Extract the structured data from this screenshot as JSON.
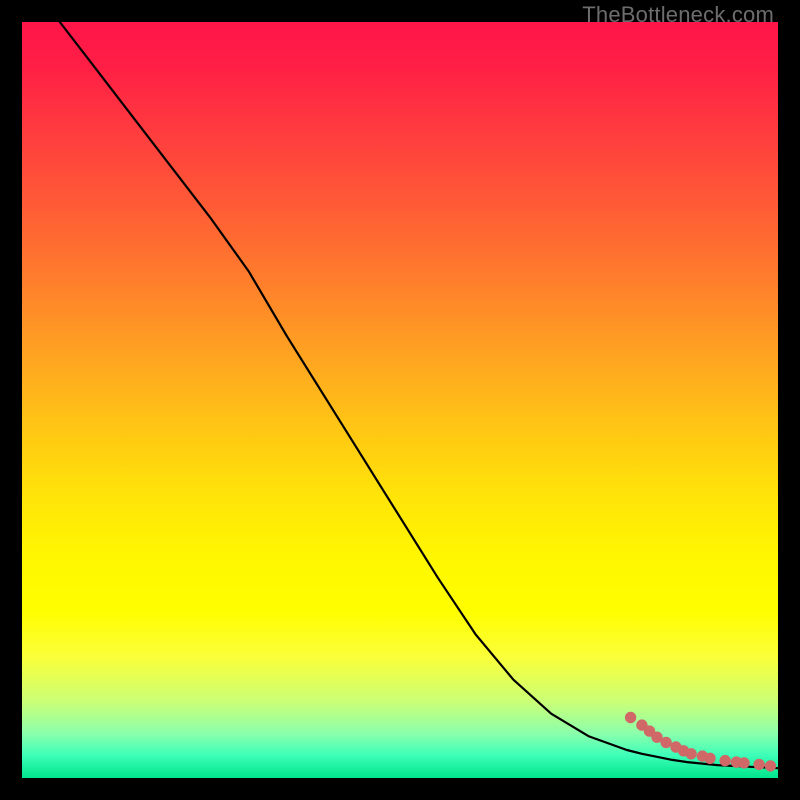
{
  "watermark": "TheBottleneck.com",
  "colors": {
    "curve": "#000000",
    "dot": "#d16868",
    "background": "#000000"
  },
  "chart_data": {
    "type": "line",
    "title": "",
    "xlabel": "",
    "ylabel": "",
    "xlim": [
      0,
      100
    ],
    "ylim": [
      0,
      100
    ],
    "grid": false,
    "series": [
      {
        "name": "curve",
        "kind": "line",
        "x": [
          5,
          10,
          15,
          20,
          25,
          30,
          35,
          40,
          45,
          50,
          55,
          60,
          65,
          70,
          75,
          80,
          82,
          84,
          86,
          88,
          90,
          92,
          94,
          96,
          98,
          100
        ],
        "y": [
          100,
          93.5,
          87,
          80.5,
          74,
          67,
          58.5,
          50.5,
          42.5,
          34.5,
          26.5,
          19,
          13,
          8.5,
          5.5,
          3.7,
          3.2,
          2.8,
          2.4,
          2.1,
          1.9,
          1.7,
          1.6,
          1.5,
          1.4,
          1.3
        ]
      },
      {
        "name": "dots",
        "kind": "scatter",
        "x": [
          80.5,
          82.0,
          83.0,
          84.0,
          85.2,
          86.5,
          87.5,
          88.5,
          90.0,
          91.0,
          93.0,
          94.5,
          95.5,
          97.5,
          99.0
        ],
        "y": [
          8.0,
          7.0,
          6.2,
          5.4,
          4.7,
          4.1,
          3.6,
          3.2,
          2.9,
          2.6,
          2.3,
          2.1,
          2.0,
          1.8,
          1.6
        ]
      }
    ]
  }
}
